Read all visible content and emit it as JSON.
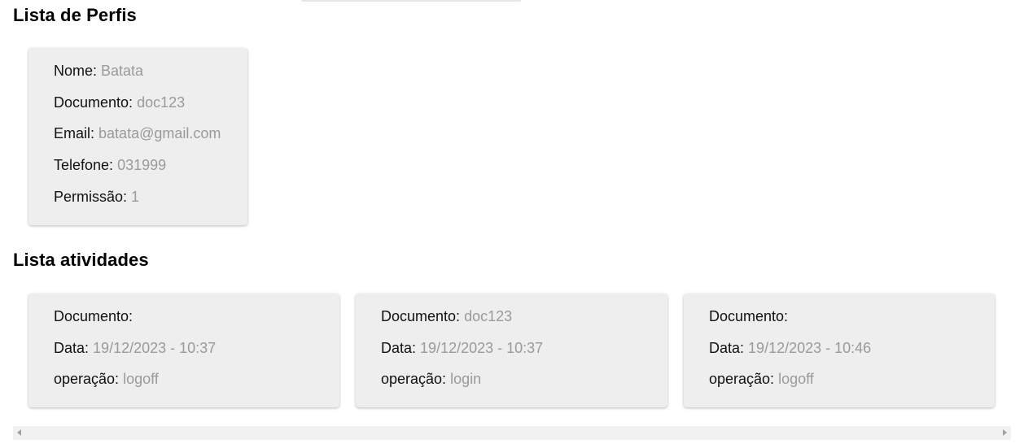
{
  "profiles_section": {
    "title": "Lista de Perfis",
    "profiles": [
      {
        "name_label": "Nome:",
        "name": "Batata",
        "document_label": "Documento:",
        "document": "doc123",
        "email_label": "Email:",
        "email": "batata@gmail.com",
        "phone_label": "Telefone:",
        "phone": "031999",
        "permission_label": "Permissão:",
        "permission": "1"
      }
    ]
  },
  "activities_section": {
    "title": "Lista atividades",
    "activities": [
      {
        "document_label": "Documento:",
        "document": "",
        "date_label": "Data:",
        "date": "19/12/2023 - 10:37",
        "operation_label": "operação:",
        "operation": "logoff"
      },
      {
        "document_label": "Documento:",
        "document": "doc123",
        "date_label": "Data:",
        "date": "19/12/2023 - 10:37",
        "operation_label": "operação:",
        "operation": "login"
      },
      {
        "document_label": "Documento:",
        "document": "",
        "date_label": "Data:",
        "date": "19/12/2023 - 10:46",
        "operation_label": "operação:",
        "operation": "logoff"
      }
    ]
  },
  "colors": {
    "card_background": "#eeeeee",
    "label_text": "#111111",
    "value_text": "#9a9a9a",
    "scrollbar_track": "#f1f1f1"
  },
  "icons": {
    "scroll_left": "triangle-left-icon",
    "scroll_right": "triangle-right-icon"
  }
}
